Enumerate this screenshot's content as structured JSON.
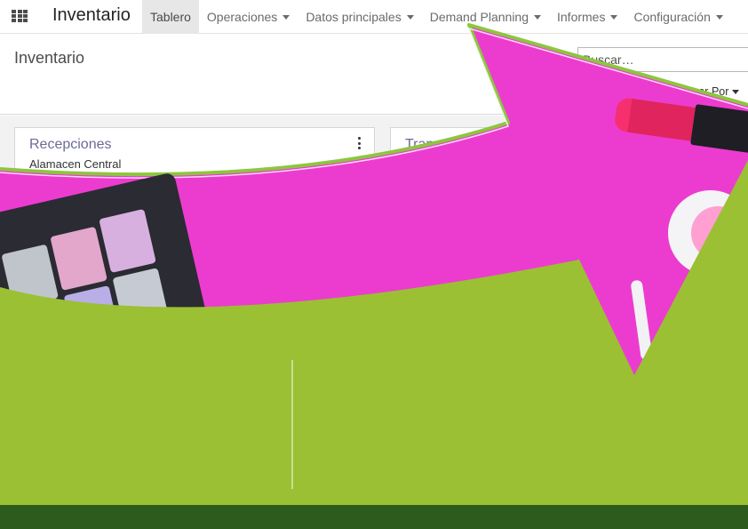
{
  "app": {
    "title": "Inventario"
  },
  "nav": {
    "menu": [
      {
        "label": "Tablero",
        "active": true,
        "has_dropdown": false
      },
      {
        "label": "Operaciones",
        "active": false,
        "has_dropdown": true
      },
      {
        "label": "Datos principales",
        "active": false,
        "has_dropdown": true
      },
      {
        "label": "Demand Planning",
        "active": false,
        "has_dropdown": true
      },
      {
        "label": "Informes",
        "active": false,
        "has_dropdown": true
      },
      {
        "label": "Configuración",
        "active": false,
        "has_dropdown": true
      }
    ]
  },
  "control_panel": {
    "title": "Inventario",
    "search": {
      "placeholder": "Buscar…",
      "value": ""
    },
    "group_by_label": "Agrupar Por"
  },
  "cards": [
    {
      "title": "Recepciones",
      "subtitle": "Alamacen Central"
    },
    {
      "title": "Tran",
      "subtitle": ""
    }
  ],
  "icons": {
    "apps": "apps-grid-icon",
    "card_menu": "kebab-menu-icon",
    "dropdown": "caret-down-icon"
  },
  "colors": {
    "overlay_magenta": "#ec3ccf",
    "overlay_green": "#9bc033",
    "overlay_dark_green": "#2d5b1d",
    "card_title": "#6b6b9a",
    "lipstick": "#f6306f"
  }
}
